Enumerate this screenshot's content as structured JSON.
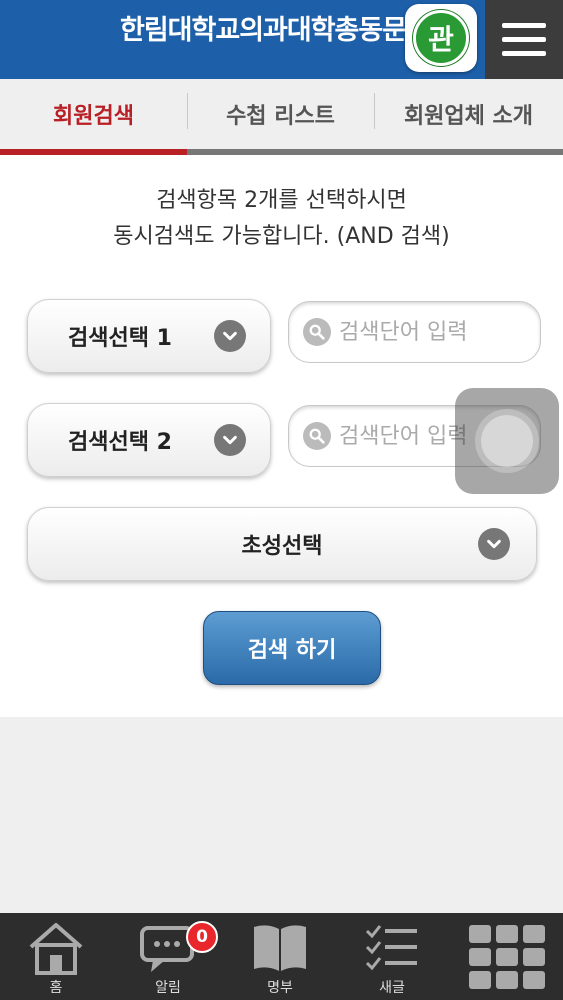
{
  "header": {
    "title": "한림대학교의과대학총동문",
    "badge_text": "관",
    "menu_icon": "hamburger-menu-icon"
  },
  "tabs": [
    {
      "label": "회원검색",
      "active": true
    },
    {
      "label": "수첩 리스트",
      "active": false
    },
    {
      "label": "회원업체 소개",
      "active": false
    }
  ],
  "main": {
    "instruction_line1": "검색항목 2개를 선택하시면",
    "instruction_line2": "동시검색도 가능합니다. (AND 검색)",
    "select1_label": "검색선택 1",
    "select2_label": "검색선택 2",
    "search1_placeholder": "검색단어 입력",
    "search2_placeholder": "검색단어 입력",
    "initial_select_label": "초성선택",
    "submit_label": "검색 하기"
  },
  "bottom_nav": {
    "items": [
      {
        "label": "홈",
        "icon": "home-icon"
      },
      {
        "label": "알림",
        "icon": "chat-bubble-icon"
      },
      {
        "label": "명부",
        "icon": "book-icon"
      },
      {
        "label": "새글",
        "icon": "checklist-icon"
      },
      {
        "label": "",
        "icon": "grid-icon"
      }
    ],
    "notification_count": "0"
  },
  "colors": {
    "header_blue": "#1d5fa8",
    "active_tab_red": "#b82026",
    "button_blue": "#2a6aa8",
    "badge_green": "#2a9a35"
  }
}
